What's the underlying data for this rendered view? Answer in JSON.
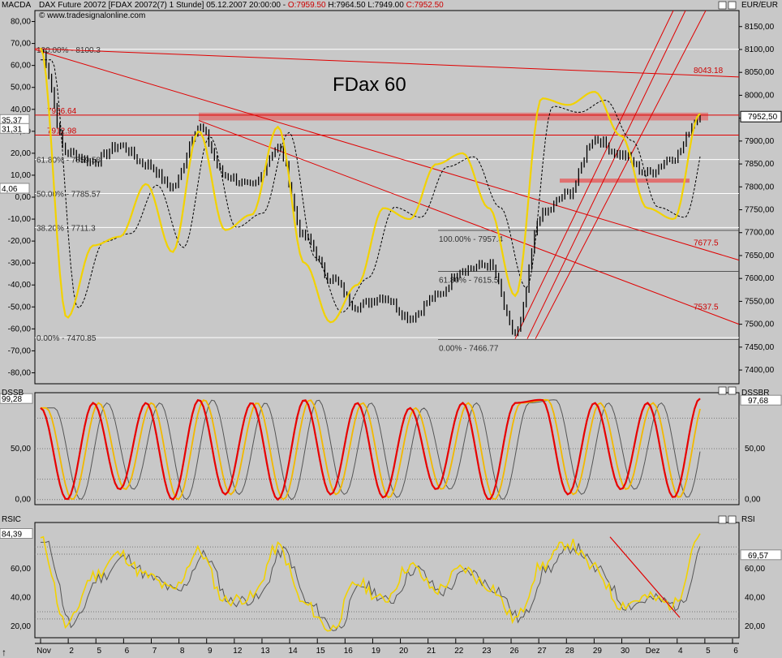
{
  "header": {
    "left_label": "MACDA",
    "instrument": "DAX Future 20072 [FDAX 20072(7)  1 Stunde] 05.12.2007 20:00:00 - ",
    "open": "O:7959.50",
    "high": "H:7964.50",
    "low": "L:7949.00",
    "close": "C:7952.50",
    "copyright": "© www.tradesignalonline.com",
    "right_unit": "EUR/EUR"
  },
  "main_panel": {
    "annotation": "FDax 60",
    "left_axis_ticks": [
      "80,00",
      "70,00",
      "60,00",
      "50,00",
      "40,00",
      "30,00",
      "20,00",
      "10,00",
      "0,00",
      "-10,00",
      "-20,00",
      "-30,00",
      "-40,00",
      "-50,00",
      "-60,00",
      "-70,00",
      "-80,00"
    ],
    "left_badges": [
      "35,37",
      "31,31",
      "4,06"
    ],
    "right_axis_ticks": [
      "8150,00",
      "8100,00",
      "8050,00",
      "8000,00",
      "7950,00",
      "7900,00",
      "7850,00",
      "7800,00",
      "7750,00",
      "7700,00",
      "7650,00",
      "7600,00",
      "7550,00",
      "7500,00",
      "7450,00",
      "7400,00"
    ],
    "right_badge": "7952,50",
    "fib_labels_1": [
      "100.00% - 8100.3",
      "61.80% - 7859.58",
      "50.00% - 7785.57",
      "38.20% - 7711.3",
      "0.00% - 7470.85"
    ],
    "fib_labels_2": [
      "100.00% - 7957.4",
      "61.80% - 7615.5",
      "0.00% - 7466.77"
    ],
    "level_labels": [
      "7956.64",
      "7912.98",
      "8043.18",
      "7677.5",
      "7537.5"
    ]
  },
  "dssb_panel": {
    "left_label": "DSSB",
    "right_label": "DSSBR",
    "left_badge": "99,28",
    "right_badge": "97,68",
    "left_ticks": [
      "50,00",
      "0,00"
    ],
    "right_ticks": [
      "50,00",
      "0,00"
    ]
  },
  "rsi_panel": {
    "left_label": "RSIC",
    "right_label": "RSI",
    "left_badge": "84,39",
    "right_badge": "69,57",
    "left_ticks": [
      "60,00",
      "40,00",
      "20,00"
    ],
    "right_ticks": [
      "60,00",
      "40,00",
      "20,00"
    ]
  },
  "x_axis": {
    "labels": [
      "Nov",
      "2",
      "5",
      "6",
      "7",
      "8",
      "9",
      "12",
      "13",
      "14",
      "15",
      "16",
      "19",
      "20",
      "21",
      "22",
      "23",
      "26",
      "27",
      "28",
      "29",
      "30",
      "Dez",
      "4",
      "5",
      "6"
    ]
  },
  "chart_data": [
    {
      "type": "line",
      "title": "DAX Future 20072 [FDAX 20072(7)  1 Stunde]",
      "x": [
        "Nov",
        "2",
        "5",
        "6",
        "7",
        "8",
        "9",
        "12",
        "13",
        "14",
        "15",
        "16",
        "19",
        "20",
        "21",
        "22",
        "23",
        "26",
        "27",
        "28",
        "29",
        "30",
        "Dez",
        "4",
        "5",
        "6"
      ],
      "series": [
        {
          "name": "FDAX",
          "values": [
            8095,
            7875,
            7855,
            7890,
            7850,
            7800,
            7930,
            7825,
            7800,
            7885,
            7690,
            7600,
            7540,
            7560,
            7515,
            7560,
            7620,
            7630,
            7480,
            7740,
            7785,
            7905,
            7870,
            7830,
            7865,
            7955
          ]
        }
      ],
      "ylim": [
        7370,
        8185
      ]
    },
    {
      "type": "line",
      "title": "MACDA",
      "x": [
        "Nov",
        "2",
        "5",
        "6",
        "7",
        "8",
        "9",
        "12",
        "13",
        "14",
        "15",
        "16",
        "19",
        "20",
        "21",
        "22",
        "23",
        "26",
        "27",
        "28",
        "29",
        "30",
        "Dez",
        "4",
        "5",
        "6"
      ],
      "values": [
        68,
        -55,
        -22,
        -18,
        6,
        -25,
        30,
        -15,
        -8,
        32,
        -30,
        -57,
        -40,
        -5,
        -10,
        15,
        20,
        -5,
        -45,
        45,
        42,
        48,
        28,
        -5,
        -10,
        38
      ],
      "ylim": [
        -85,
        85
      ]
    },
    {
      "type": "line",
      "title": "DSSB",
      "x": [
        "Nov",
        "2",
        "5",
        "6",
        "7",
        "8",
        "9",
        "12",
        "13",
        "14",
        "15",
        "16",
        "19",
        "20",
        "21",
        "22",
        "23",
        "26",
        "27",
        "28",
        "29",
        "30",
        "Dez",
        "4",
        "5",
        "6"
      ],
      "values": [
        90,
        0,
        95,
        10,
        95,
        0,
        98,
        5,
        95,
        0,
        98,
        5,
        95,
        2,
        90,
        10,
        95,
        0,
        95,
        98,
        5,
        95,
        10,
        95,
        2,
        99.28
      ],
      "ylim": [
        -5,
        105
      ]
    },
    {
      "type": "line",
      "title": "RSIC",
      "x": [
        "Nov",
        "2",
        "5",
        "6",
        "7",
        "8",
        "9",
        "12",
        "13",
        "14",
        "15",
        "16",
        "19",
        "20",
        "21",
        "22",
        "23",
        "26",
        "27",
        "28",
        "29",
        "30",
        "Dez",
        "4",
        "5",
        "6"
      ],
      "values": [
        80,
        20,
        55,
        70,
        55,
        45,
        72,
        38,
        40,
        75,
        35,
        18,
        50,
        38,
        62,
        45,
        60,
        48,
        25,
        62,
        78,
        60,
        35,
        40,
        35,
        84.39
      ],
      "ylim": [
        12,
        92
      ]
    }
  ],
  "colors": {
    "background": "#c8c8c8",
    "price": "#000000",
    "macd": "#f2d200",
    "fib": "#ffffff",
    "trend": "#e00000",
    "dssb_fast": "#e80000",
    "dssb_mid": "#f2b800",
    "dssb_slow": "#555555"
  }
}
